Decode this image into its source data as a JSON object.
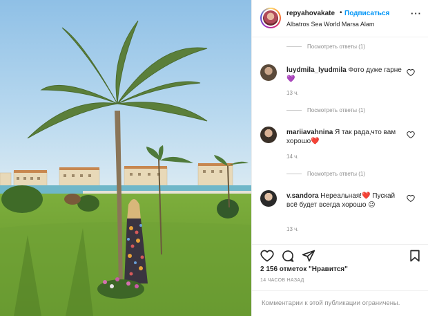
{
  "post": {
    "username": "repyahovakate",
    "separator": "•",
    "follow_label": "Подписаться",
    "location": "Albatros Sea World Marsa Alam",
    "more_icon": "more-horizontal-icon"
  },
  "comments": {
    "view_replies_label": "Посмотреть ответы (1)",
    "items": [
      {
        "username": "luydmila_lyudmila",
        "text": "Фото дуже гарне 💜",
        "time": "13 ч.",
        "avatar_color": "#5a4a3a"
      },
      {
        "username": "mariiavahnina",
        "text": "Я так рада,что вам хорошо❤️",
        "time": "14 ч.",
        "avatar_color": "#3a3028"
      },
      {
        "username": "v.sandora",
        "text": "Нереальная!❤️ Пускай всё будет всегда хорошо 😉",
        "time": "13 ч.",
        "avatar_color": "#2a2a2a"
      }
    ]
  },
  "actions": {
    "like_icon": "heart-icon",
    "comment_icon": "comment-icon",
    "share_icon": "paper-plane-icon",
    "save_icon": "bookmark-icon",
    "likes_text": "2 156 отметок \"Нравится\"",
    "timestamp": "14 ЧАСОВ НАЗАД"
  },
  "footer": {
    "restricted_text": "Комментарии к этой публикации ограничены."
  },
  "colors": {
    "accent": "#0095f6",
    "muted": "#8e8e8e",
    "text": "#262626"
  }
}
